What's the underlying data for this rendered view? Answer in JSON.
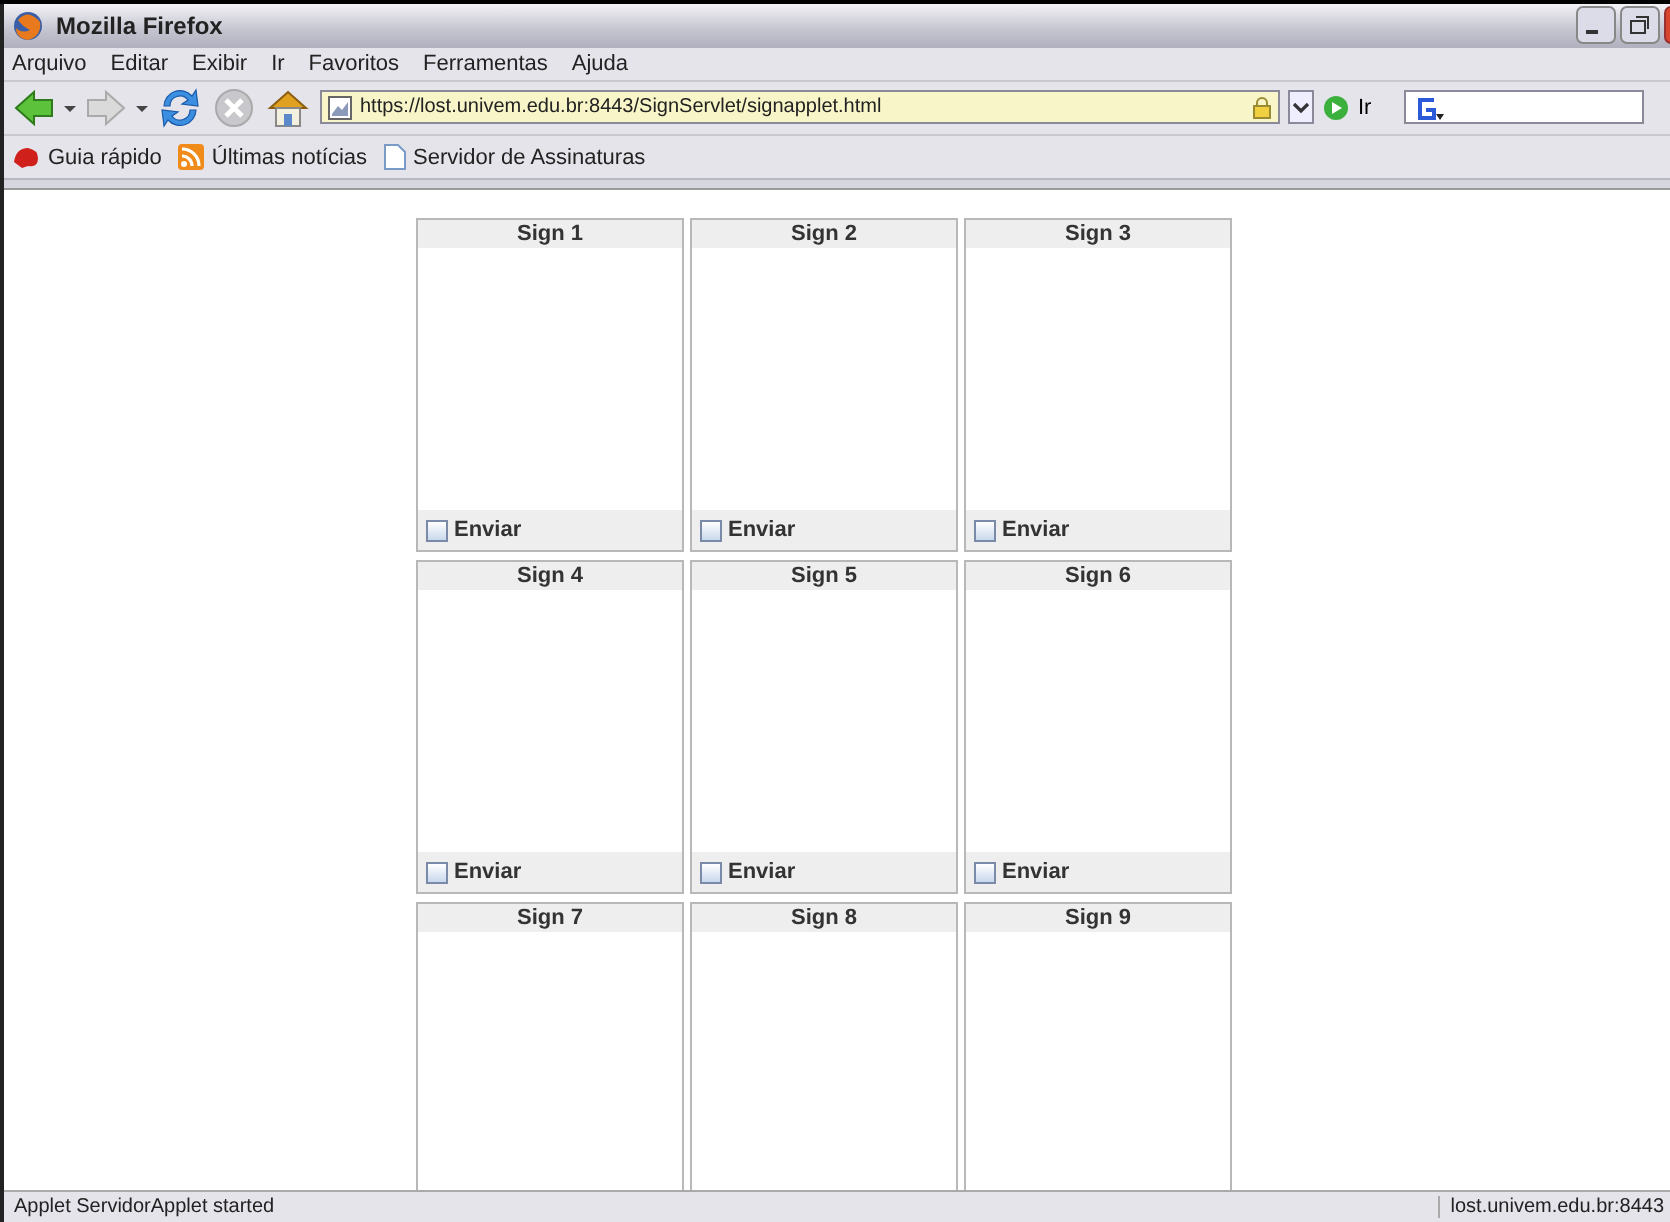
{
  "window": {
    "title": "Mozilla Firefox"
  },
  "menu": [
    "Arquivo",
    "Editar",
    "Exibir",
    "Ir",
    "Favoritos",
    "Ferramentas",
    "Ajuda"
  ],
  "navbar": {
    "url": "https://lost.univem.edu.br:8443/SignServlet/signapplet.html",
    "go": "Ir"
  },
  "bookmarks": [
    {
      "kind": "site",
      "label": "Guia rápido"
    },
    {
      "kind": "feed",
      "label": "Últimas notícias"
    },
    {
      "kind": "page",
      "label": "Servidor de Assinaturas"
    }
  ],
  "panels": [
    {
      "title": "Sign 1",
      "footer": {
        "label": "Enviar",
        "checked": false
      }
    },
    {
      "title": "Sign 2",
      "footer": {
        "label": "Enviar",
        "checked": false
      }
    },
    {
      "title": "Sign 3",
      "footer": {
        "label": "Enviar",
        "checked": false
      }
    },
    {
      "title": "Sign 4",
      "footer": {
        "label": "Enviar",
        "checked": false
      }
    },
    {
      "title": "Sign 5",
      "footer": {
        "label": "Enviar",
        "checked": false
      }
    },
    {
      "title": "Sign 6",
      "footer": {
        "label": "Enviar",
        "checked": false
      }
    },
    {
      "title": "Sign 7"
    },
    {
      "title": "Sign 8"
    },
    {
      "title": "Sign 9"
    }
  ],
  "status_bar": {
    "message": "Applet ServidorApplet started",
    "host": "lost.univem.edu.br:8443"
  }
}
